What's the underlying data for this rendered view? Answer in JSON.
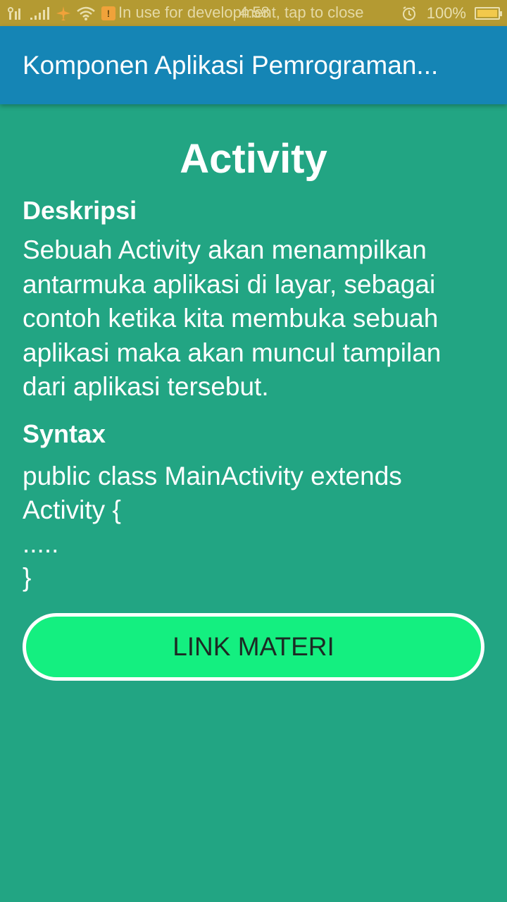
{
  "status_bar": {
    "notice": "In use for development, tap to close",
    "time": "4:58",
    "battery_text": "100%",
    "battery_level": 1.0,
    "icons": [
      "sim-icon",
      "signal-icon",
      "airplane-icon",
      "wifi-icon",
      "developer-mode-icon",
      "alarm-icon",
      "battery-icon"
    ]
  },
  "app_bar": {
    "title": "Komponen Aplikasi Pemrograman..."
  },
  "content": {
    "heading": "Activity",
    "description_label": "Deskripsi",
    "description_text": "Sebuah Activity akan menampilkan antarmuka aplikasi di layar, sebagai contoh ketika kita membuka sebuah aplikasi maka akan muncul tampilan dari aplikasi tersebut.",
    "syntax_label": "Syntax",
    "syntax_code": "public class MainActivity extends Activity {\n.....\n}"
  },
  "button": {
    "label": "LINK MATERI"
  },
  "colors": {
    "background": "#22a583",
    "app_bar": "#1585b5",
    "status_bar": "#b49a32",
    "button": "#14ef80",
    "button_border": "#ffffff"
  }
}
